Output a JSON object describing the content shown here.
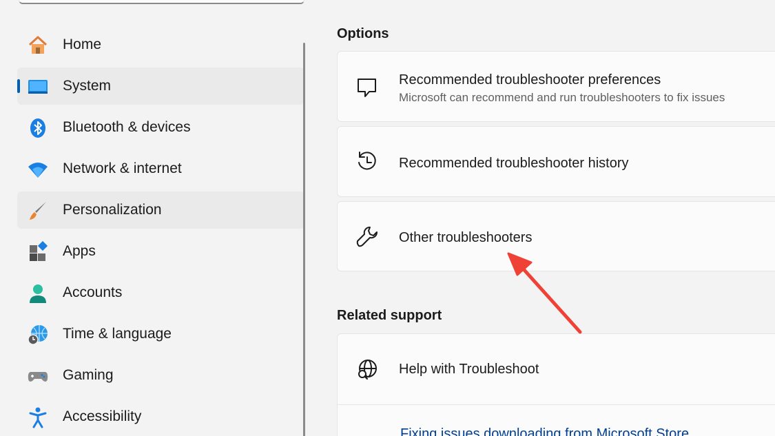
{
  "sidebar": {
    "items": [
      {
        "label": "Home",
        "icon": "home-icon"
      },
      {
        "label": "System",
        "icon": "system-icon"
      },
      {
        "label": "Bluetooth & devices",
        "icon": "bluetooth-icon"
      },
      {
        "label": "Network & internet",
        "icon": "wifi-icon"
      },
      {
        "label": "Personalization",
        "icon": "paintbrush-icon"
      },
      {
        "label": "Apps",
        "icon": "apps-icon"
      },
      {
        "label": "Accounts",
        "icon": "person-icon"
      },
      {
        "label": "Time & language",
        "icon": "globe-clock-icon"
      },
      {
        "label": "Gaming",
        "icon": "gamepad-icon"
      },
      {
        "label": "Accessibility",
        "icon": "accessibility-icon"
      }
    ],
    "selected": "System"
  },
  "main": {
    "options_title": "Options",
    "options": [
      {
        "title": "Recommended troubleshooter preferences",
        "subtitle": "Microsoft can recommend and run troubleshooters to fix issues",
        "icon": "chat-bubble-icon"
      },
      {
        "title": "Recommended troubleshooter history",
        "icon": "history-icon"
      },
      {
        "title": "Other troubleshooters",
        "icon": "wrench-icon"
      }
    ],
    "related_title": "Related support",
    "related": {
      "title": "Help with Troubleshoot",
      "icon": "globe-search-icon",
      "link": "Fixing issues downloading from Microsoft Store"
    }
  },
  "colors": {
    "accent": "#005fb8",
    "annotation_arrow": "#ef4136"
  }
}
